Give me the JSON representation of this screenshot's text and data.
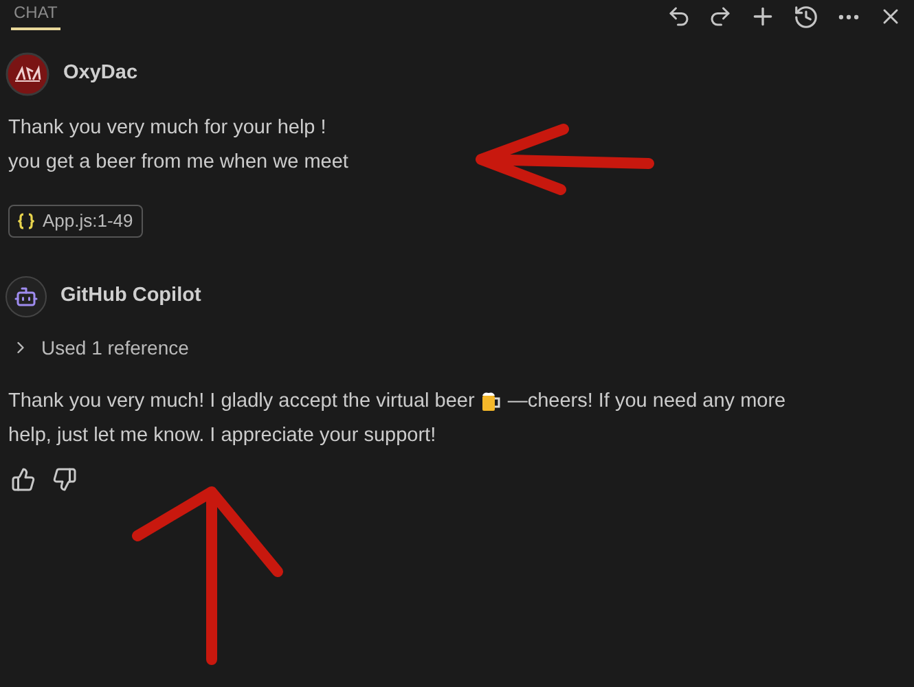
{
  "tabs": [
    {
      "label": "CHAT",
      "selected": true
    }
  ],
  "messages": [
    {
      "kind": "user",
      "author": "OxyDac",
      "lines": [
        "Thank you very much for your help !",
        "you get a beer from me when we meet"
      ],
      "attachment": "App.js:1-49"
    },
    {
      "kind": "assistant",
      "author": "GitHub Copilot",
      "references": "Used 1 reference",
      "expanded": false,
      "text_before": "Thank you very much! I gladly accept the virtual beer",
      "text_after": "—cheers! If you need any more",
      "text_line_2": "help, just let me know. I appreciate your support!"
    }
  ]
}
